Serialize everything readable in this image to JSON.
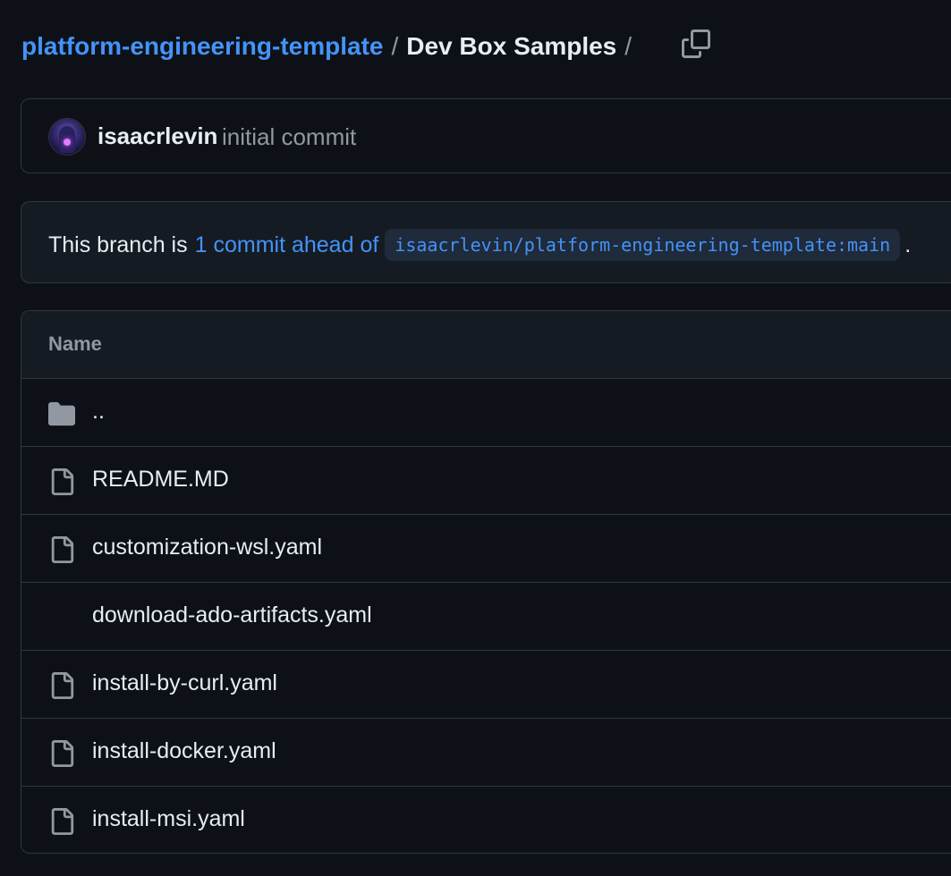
{
  "breadcrumb": {
    "repo": "platform-engineering-template",
    "separator": "/",
    "current": "Dev Box Samples",
    "trailing_separator": "/",
    "copy_icon": "copy-icon"
  },
  "commit": {
    "author": "isaacrlevin",
    "message": "initial commit",
    "avatar_icon": "avatar"
  },
  "branch": {
    "prefix": "This branch is",
    "link": "1 commit ahead of",
    "ref": "isaacrlevin/platform-engineering-template:main",
    "suffix": "."
  },
  "table": {
    "header": "Name",
    "rows": [
      {
        "name": "..",
        "icon": "folder-icon"
      },
      {
        "name": "README.MD",
        "icon": "file-icon"
      },
      {
        "name": "customization-wsl.yaml",
        "icon": "file-icon"
      },
      {
        "name": "download-ado-artifacts.yaml",
        "icon": "file-icon"
      },
      {
        "name": "install-by-curl.yaml",
        "icon": "file-icon"
      },
      {
        "name": "install-docker.yaml",
        "icon": "file-icon"
      },
      {
        "name": "install-msi.yaml",
        "icon": "file-icon"
      }
    ]
  },
  "colors": {
    "background": "#0d1117",
    "link": "#4493f8",
    "text": "#e6edf3",
    "muted": "#9198a1",
    "border": "#30363d"
  }
}
